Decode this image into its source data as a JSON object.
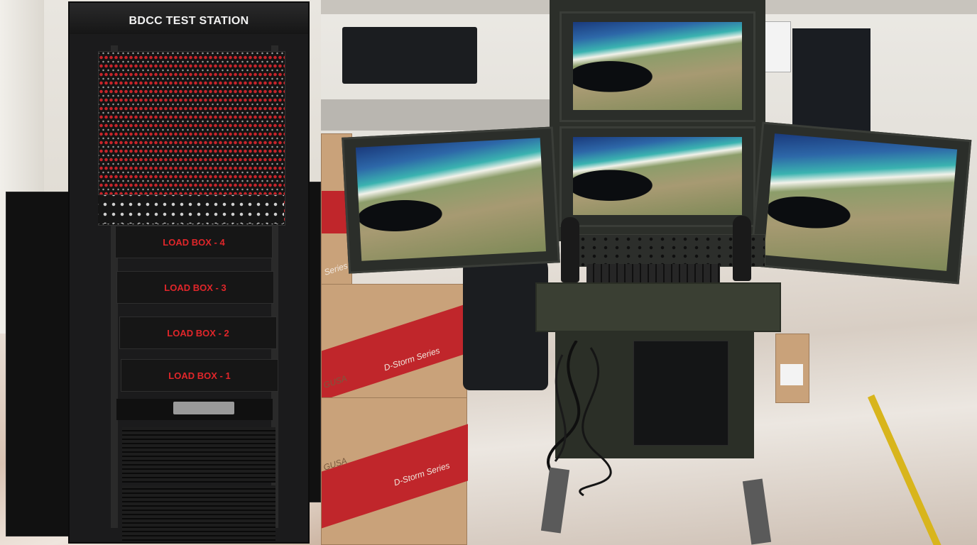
{
  "left_photo": {
    "rack_title": "BDCC TEST STATION",
    "load_boxes": [
      "LOAD BOX - 4",
      "LOAD BOX - 3",
      "LOAD BOX - 2",
      "LOAD BOX - 1"
    ],
    "label_color": "#e0262a"
  },
  "right_photo": {
    "box_print": [
      "D-Storm Series",
      "D-Storm Series"
    ],
    "box_brand": [
      "GUSA",
      "GUSA"
    ],
    "box_side_label": "Series",
    "monitor_count": 4,
    "accent_colors": {
      "box_stripe": "#c0262b",
      "floor_line": "#d8b51c",
      "desk": "#3a3f33"
    }
  }
}
